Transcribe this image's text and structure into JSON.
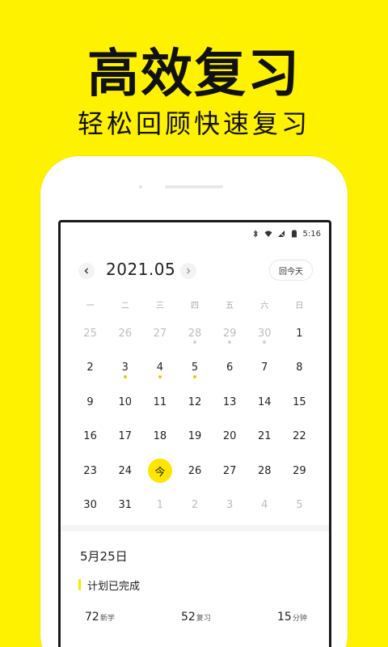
{
  "hero": {
    "title": "高效复习",
    "subtitle": "轻松回顾快速复习"
  },
  "status_bar": {
    "time": "5:16",
    "icons": [
      "bluetooth-icon",
      "wifi-icon",
      "no-signal-icon",
      "battery-icon"
    ]
  },
  "calendar": {
    "month": "2021.05",
    "today_button": "回今天",
    "prev_icon": "chevron-left-icon",
    "next_icon": "chevron-right-icon",
    "weekdays": [
      "一",
      "二",
      "三",
      "四",
      "五",
      "六",
      "日"
    ],
    "weeks": [
      [
        {
          "label": "25",
          "muted": true,
          "mark": null
        },
        {
          "label": "26",
          "muted": true,
          "mark": null
        },
        {
          "label": "27",
          "muted": true,
          "mark": null
        },
        {
          "label": "28",
          "muted": true,
          "mark": "gray"
        },
        {
          "label": "29",
          "muted": true,
          "mark": "gray"
        },
        {
          "label": "30",
          "muted": true,
          "mark": "gray"
        },
        {
          "label": "1",
          "muted": false,
          "mark": null
        }
      ],
      [
        {
          "label": "2",
          "muted": false,
          "mark": null
        },
        {
          "label": "3",
          "muted": false,
          "mark": "yellow"
        },
        {
          "label": "4",
          "muted": false,
          "mark": "yellow"
        },
        {
          "label": "5",
          "muted": false,
          "mark": "yellow"
        },
        {
          "label": "6",
          "muted": false,
          "mark": null
        },
        {
          "label": "7",
          "muted": false,
          "mark": null
        },
        {
          "label": "8",
          "muted": false,
          "mark": null
        }
      ],
      [
        {
          "label": "9",
          "muted": false,
          "mark": null
        },
        {
          "label": "10",
          "muted": false,
          "mark": null
        },
        {
          "label": "11",
          "muted": false,
          "mark": null
        },
        {
          "label": "12",
          "muted": false,
          "mark": null
        },
        {
          "label": "13",
          "muted": false,
          "mark": null
        },
        {
          "label": "14",
          "muted": false,
          "mark": null
        },
        {
          "label": "15",
          "muted": false,
          "mark": null
        }
      ],
      [
        {
          "label": "16",
          "muted": false,
          "mark": null
        },
        {
          "label": "17",
          "muted": false,
          "mark": null
        },
        {
          "label": "18",
          "muted": false,
          "mark": null
        },
        {
          "label": "19",
          "muted": false,
          "mark": null
        },
        {
          "label": "20",
          "muted": false,
          "mark": null
        },
        {
          "label": "21",
          "muted": false,
          "mark": null
        },
        {
          "label": "22",
          "muted": false,
          "mark": null
        }
      ],
      [
        {
          "label": "23",
          "muted": false,
          "mark": null
        },
        {
          "label": "24",
          "muted": false,
          "mark": null
        },
        {
          "label": "今",
          "muted": false,
          "mark": null,
          "today": true
        },
        {
          "label": "26",
          "muted": false,
          "mark": null
        },
        {
          "label": "27",
          "muted": false,
          "mark": null
        },
        {
          "label": "28",
          "muted": false,
          "mark": null
        },
        {
          "label": "29",
          "muted": false,
          "mark": null
        }
      ],
      [
        {
          "label": "30",
          "muted": false,
          "mark": null
        },
        {
          "label": "31",
          "muted": false,
          "mark": null
        },
        {
          "label": "1",
          "muted": true,
          "mark": null
        },
        {
          "label": "2",
          "muted": true,
          "mark": null
        },
        {
          "label": "3",
          "muted": true,
          "mark": null
        },
        {
          "label": "4",
          "muted": true,
          "mark": null
        },
        {
          "label": "5",
          "muted": true,
          "mark": null
        }
      ]
    ]
  },
  "summary": {
    "date": "5月25日",
    "section_title": "计划已完成",
    "stats": [
      {
        "value": "72",
        "unit": "新学"
      },
      {
        "value": "52",
        "unit": "复习"
      },
      {
        "value": "15",
        "unit": "分钟"
      }
    ]
  },
  "colors": {
    "background": "#FFF200",
    "accent": "#FFE600",
    "mark_yellow": "#F5C400",
    "mark_gray": "#D3D3D3"
  }
}
